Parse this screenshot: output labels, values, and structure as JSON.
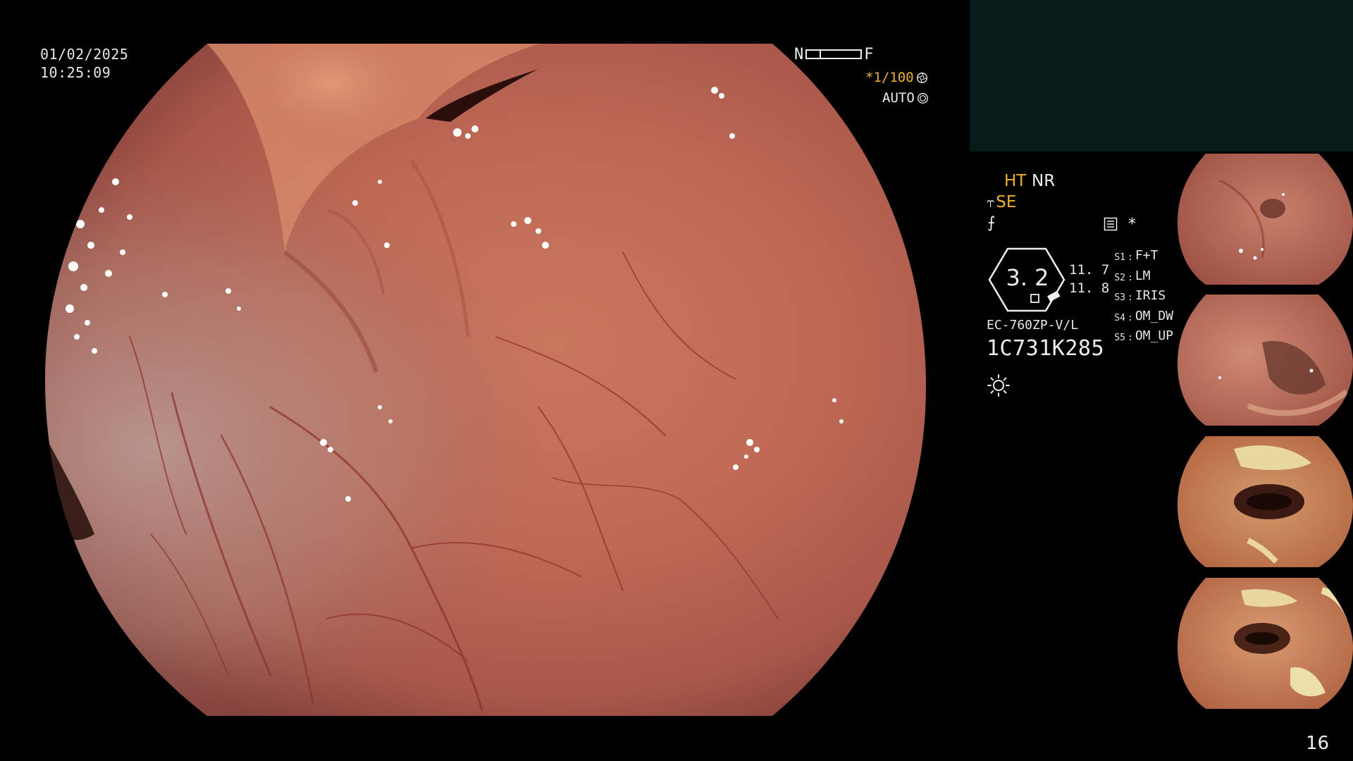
{
  "overlay": {
    "date": "01/02/2025",
    "time": "10:25:09",
    "nf_left": "N",
    "nf_right": "F",
    "shutter": "*1/100",
    "iris_mode": "AUTO",
    "accent_color": "#f2b318"
  },
  "modes": {
    "ht": "HT",
    "nr": "NR",
    "se": "SE",
    "star": "*"
  },
  "gauge": {
    "value": "3. 2",
    "reading_1": "11. 7",
    "reading_2": "11. 8"
  },
  "scope": {
    "model": "EC-760ZP-V/L",
    "serial": "1C731K285"
  },
  "switches": [
    {
      "key": "S1",
      "value": "F+T"
    },
    {
      "key": "S2",
      "value": "LM"
    },
    {
      "key": "S3",
      "value": "IRIS"
    },
    {
      "key": "S4",
      "value": "OM_DW"
    },
    {
      "key": "S5",
      "value": "OM_UP"
    }
  ],
  "icons": {
    "shutter": "aperture-icon",
    "auto": "iris-auto-icon",
    "scene": "scene-mode-icon",
    "light": "light-source-icon",
    "se_prefix": "structure-enhance-icon"
  },
  "thumbnails": [
    {
      "name": "thumbnail-1"
    },
    {
      "name": "thumbnail-2"
    },
    {
      "name": "thumbnail-3"
    },
    {
      "name": "thumbnail-4"
    }
  ],
  "page_number": "16"
}
